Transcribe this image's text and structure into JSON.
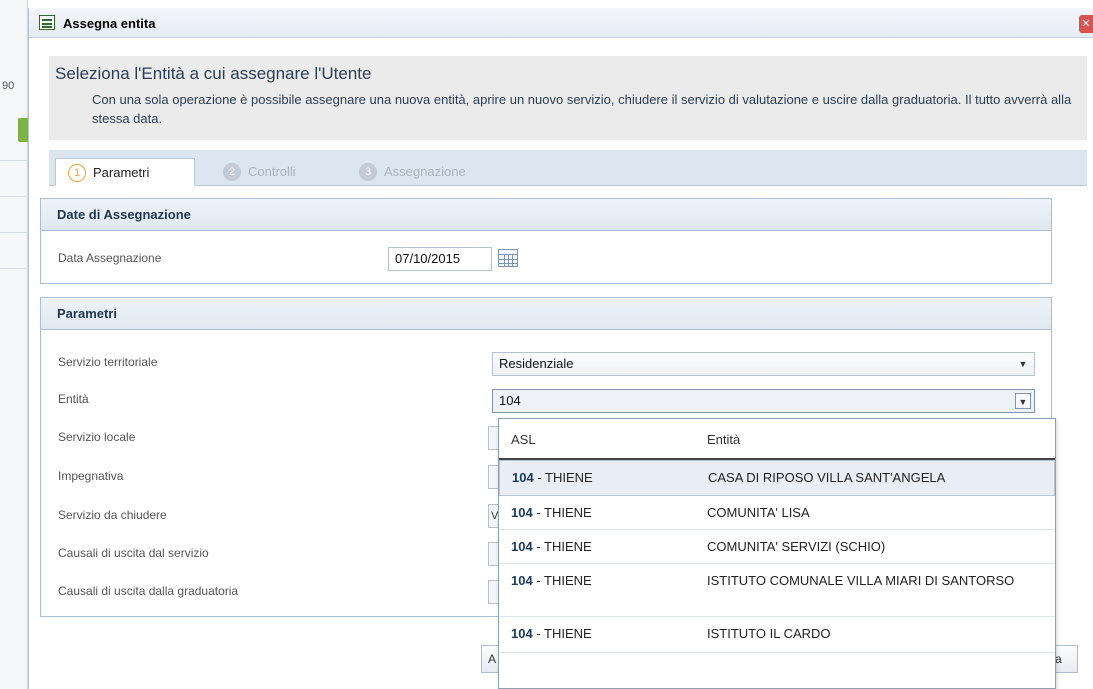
{
  "background_app": {
    "partial_number": "90"
  },
  "window": {
    "title": "Assegna entita"
  },
  "intro": {
    "headline": "Seleziona l'Entità a cui assegnare l'Utente",
    "description": "Con una sola operazione è possibile assegnare una nuova entità, aprire un nuovo servizio, chiudere il servizio di valutazione e uscire dalla graduatoria. Il tutto avverrà alla stessa data."
  },
  "tabs": [
    {
      "step": "1",
      "label": "Parametri",
      "active": true
    },
    {
      "step": "2",
      "label": "Controlli",
      "active": false
    },
    {
      "step": "3",
      "label": "Assegnazione",
      "active": false
    }
  ],
  "dates_panel": {
    "title": "Date di Assegnazione",
    "date_label": "Data Assegnazione",
    "date_value": "07/10/2015"
  },
  "params_panel": {
    "title": "Parametri",
    "fields": [
      {
        "label": "Servizio territoriale",
        "value": "Residenziale"
      },
      {
        "label": "Entità",
        "value": "104"
      },
      {
        "label": "Servizio locale",
        "value": ""
      },
      {
        "label": "Impegnativa",
        "value": ""
      },
      {
        "label": "Servizio da chiudere",
        "value": "V"
      },
      {
        "label": "Causali di uscita dal servizio",
        "value": ""
      },
      {
        "label": "Causali di uscita dalla graduatoria",
        "value": ""
      }
    ]
  },
  "buttons_peek": {
    "left_fragment": "A",
    "right_fragment": "a"
  },
  "dropdown": {
    "columns": {
      "asl": "ASL",
      "entita": "Entità"
    },
    "rows": [
      {
        "code": "104",
        "asl_rest": " - THIENE",
        "entita": "CASA DI RIPOSO VILLA SANT'ANGELA"
      },
      {
        "code": "104",
        "asl_rest": " - THIENE",
        "entita": "COMUNITA' LISA"
      },
      {
        "code": "104",
        "asl_rest": " - THIENE",
        "entita": "COMUNITA' SERVIZI (SCHIO)"
      },
      {
        "code": "104",
        "asl_rest": " - THIENE",
        "entita": "ISTITUTO COMUNALE VILLA MIARI DI SANTORSO"
      },
      {
        "code": "104",
        "asl_rest": " - THIENE",
        "entita": "ISTITUTO IL CARDO"
      }
    ]
  }
}
